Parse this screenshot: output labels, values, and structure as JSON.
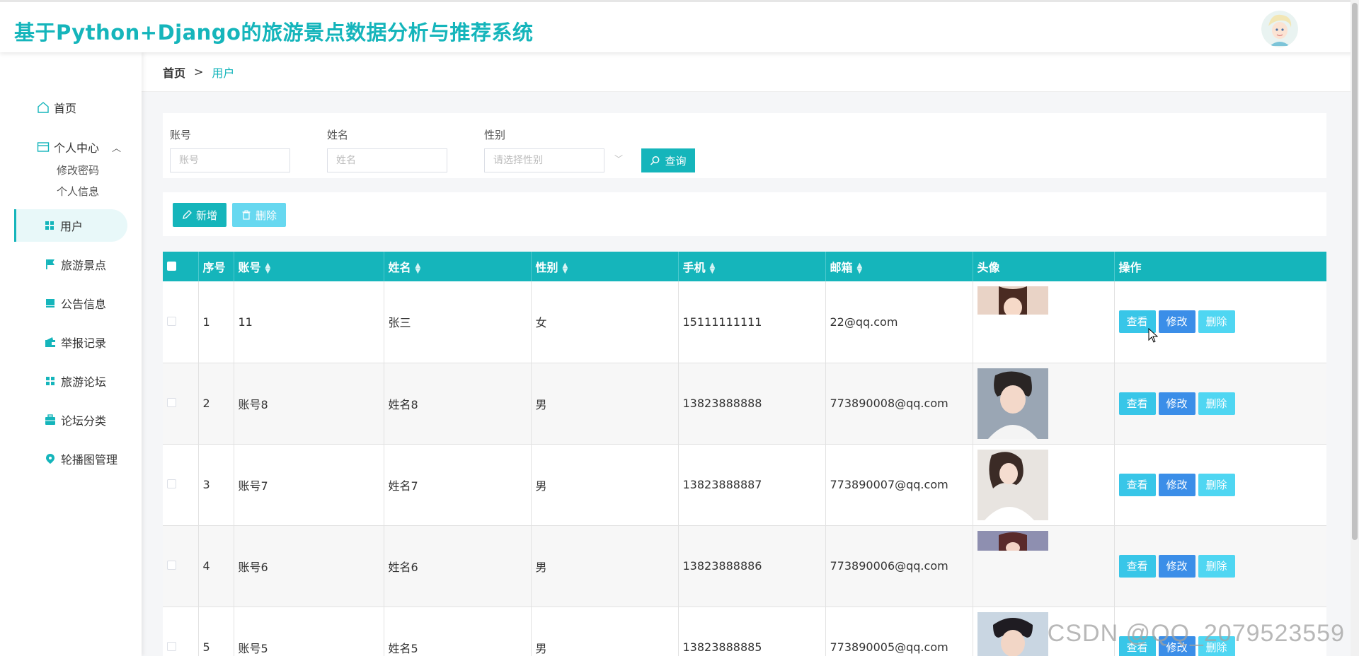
{
  "header": {
    "title": "基于Python+Django的旅游景点数据分析与推荐系统"
  },
  "sidebar": {
    "home": "首页",
    "personal_center": "个人中心",
    "personal_sub": [
      "修改密码",
      "个人信息"
    ],
    "items": [
      {
        "label": "用户",
        "icon": "grid-icon",
        "active": true
      },
      {
        "label": "旅游景点",
        "icon": "flag-icon",
        "active": false
      },
      {
        "label": "公告信息",
        "icon": "book-icon",
        "active": false
      },
      {
        "label": "举报记录",
        "icon": "wallet-icon",
        "active": false
      },
      {
        "label": "旅游论坛",
        "icon": "grid-icon",
        "active": false
      },
      {
        "label": "论坛分类",
        "icon": "briefcase-icon",
        "active": false
      },
      {
        "label": "轮播图管理",
        "icon": "pin-icon",
        "active": false
      }
    ]
  },
  "breadcrumb": {
    "home": "首页",
    "separator": ">",
    "current": "用户"
  },
  "search": {
    "account_label": "账号",
    "account_placeholder": "账号",
    "name_label": "姓名",
    "name_placeholder": "姓名",
    "gender_label": "性别",
    "gender_placeholder": "请选择性别",
    "query_button": "查询"
  },
  "actions": {
    "add_button": "新增",
    "delete_button": "删除"
  },
  "table": {
    "columns": [
      "序号",
      "账号",
      "姓名",
      "性别",
      "手机",
      "邮箱",
      "头像",
      "操作"
    ],
    "rows": [
      {
        "index": "1",
        "account": "11",
        "name": "张三",
        "gender": "女",
        "phone": "15111111111",
        "email": "22@qq.com"
      },
      {
        "index": "2",
        "account": "账号8",
        "name": "姓名8",
        "gender": "男",
        "phone": "13823888888",
        "email": "773890008@qq.com"
      },
      {
        "index": "3",
        "account": "账号7",
        "name": "姓名7",
        "gender": "男",
        "phone": "13823888887",
        "email": "773890007@qq.com"
      },
      {
        "index": "4",
        "account": "账号6",
        "name": "姓名6",
        "gender": "男",
        "phone": "13823888886",
        "email": "773890006@qq.com"
      },
      {
        "index": "5",
        "account": "账号5",
        "name": "姓名5",
        "gender": "男",
        "phone": "13823888885",
        "email": "773890005@qq.com"
      }
    ],
    "op_view": "查看",
    "op_edit": "修改",
    "op_delete": "删除"
  },
  "watermark": "CSDN @QQ_2079523559",
  "colors": {
    "primary": "#15b5bb",
    "view_button": "#38c6e8",
    "edit_button": "#3b8ee8",
    "delete_button": "#4fd6f2"
  }
}
